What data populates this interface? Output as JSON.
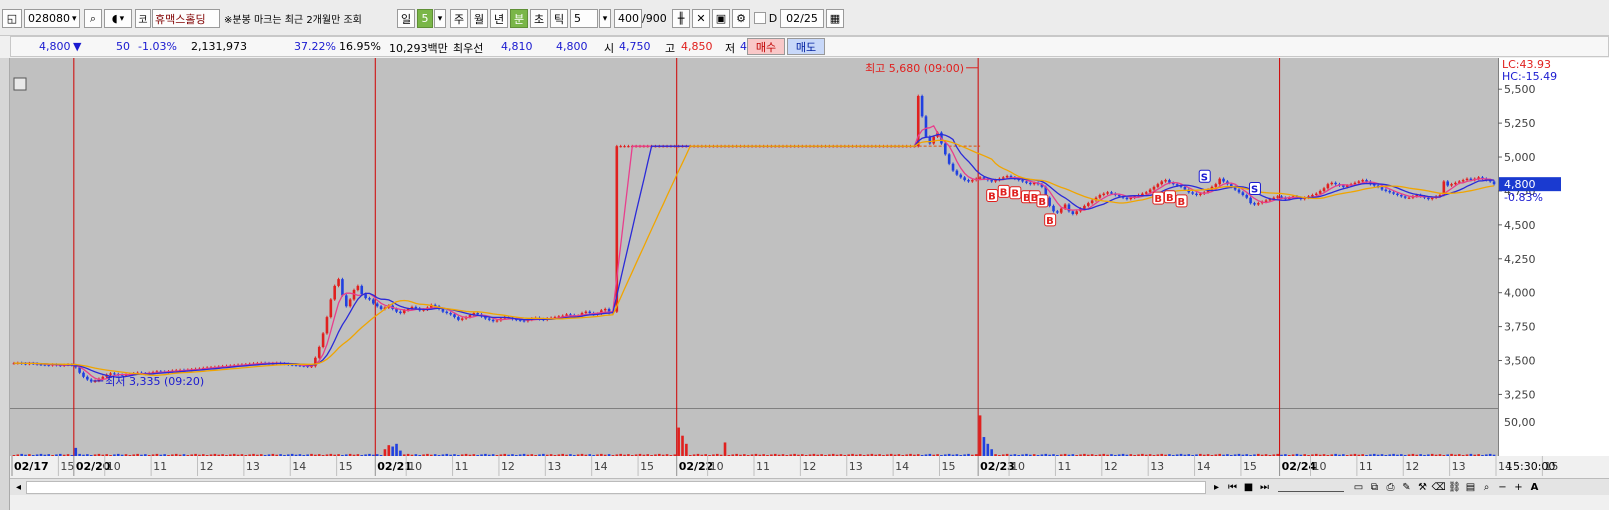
{
  "toolbar": {
    "stock_code": "028080",
    "market_badge": "코",
    "stock_name": "휴맥스홀딩",
    "notice": "※분봉 마크는 최근 2개월만 조회",
    "period_day": "일",
    "interval_value": "5",
    "period_week": "주",
    "period_month": "월",
    "period_year": "년",
    "period_minute": "분",
    "period_second": "초",
    "period_tick": "틱",
    "period_count": "5",
    "bar_count": "400",
    "bar_max": "/900",
    "check_label": "D",
    "date": "02/25"
  },
  "quote": {
    "price": "4,800",
    "change_arrow": "▼",
    "change": "50",
    "change_rate": "-1.03%",
    "volume": "2,131,973",
    "ratio1": "37.22%",
    "ratio2": "16.95%",
    "amount": "10,293백만",
    "best_label": "최우선",
    "best_ask": "4,810",
    "best_bid": "4,800",
    "open_label": "시",
    "open": "4,750",
    "high_label": "고",
    "high": "4,850",
    "low_label": "저",
    "low": "4,600",
    "buy_label": "매수",
    "sell_label": "매도"
  },
  "colors": {
    "up": "#e0201e",
    "down": "#2040e0",
    "ma5": "#e83e8c",
    "ma10": "#2a2ad8",
    "ma20": "#f0a500",
    "plot_bg": "#c0c0c0",
    "day_sep": "#d00000"
  },
  "chart_data": {
    "type": "candlestick",
    "y_ticks": [
      3250,
      3500,
      3750,
      4000,
      4250,
      4500,
      4750,
      5000,
      5250,
      5500
    ],
    "y_tick_labels": [
      "3,250",
      "3,500",
      "3,750",
      "4,000",
      "4,250",
      "4,500",
      "4,750",
      "5,000",
      "5,250",
      "5,500"
    ],
    "ylim": [
      3150,
      5730
    ],
    "vol_tick": 50,
    "vol_tick_label": "50,00",
    "lc_label": "LC:43.93",
    "hc_label": "HC:-15.49",
    "current_price": 4800,
    "current_price_label": "4,800",
    "current_change_label": "-0.83%",
    "day_length": 78,
    "days": [
      {
        "label": "02/17",
        "start": 0,
        "hours": [
          {
            "i": 12,
            "label": "15"
          }
        ]
      },
      {
        "label": "02/20",
        "start": 16,
        "hours": [
          {
            "i": 24,
            "label": "10"
          },
          {
            "i": 36,
            "label": "11"
          },
          {
            "i": 48,
            "label": "12"
          },
          {
            "i": 60,
            "label": "13"
          },
          {
            "i": 72,
            "label": "14"
          },
          {
            "i": 84,
            "label": "15"
          }
        ]
      },
      {
        "label": "02/21",
        "start": 94,
        "hours": [
          {
            "i": 102,
            "label": "10"
          },
          {
            "i": 114,
            "label": "11"
          },
          {
            "i": 126,
            "label": "12"
          },
          {
            "i": 138,
            "label": "13"
          },
          {
            "i": 150,
            "label": "14"
          },
          {
            "i": 162,
            "label": "15"
          }
        ]
      },
      {
        "label": "02/22",
        "start": 172,
        "hours": [
          {
            "i": 180,
            "label": "10"
          },
          {
            "i": 192,
            "label": "11"
          },
          {
            "i": 204,
            "label": "12"
          },
          {
            "i": 216,
            "label": "13"
          },
          {
            "i": 228,
            "label": "14"
          },
          {
            "i": 240,
            "label": "15"
          }
        ]
      },
      {
        "label": "02/23",
        "start": 250,
        "hours": [
          {
            "i": 258,
            "label": "10"
          },
          {
            "i": 270,
            "label": "11"
          },
          {
            "i": 282,
            "label": "12"
          },
          {
            "i": 294,
            "label": "13"
          },
          {
            "i": 306,
            "label": "14"
          },
          {
            "i": 318,
            "label": "15"
          }
        ]
      },
      {
        "label": "02/24",
        "start": 328,
        "hours": [
          {
            "i": 336,
            "label": "10"
          },
          {
            "i": 348,
            "label": "11"
          },
          {
            "i": 360,
            "label": "12"
          },
          {
            "i": 372,
            "label": "13"
          },
          {
            "i": 384,
            "label": "14"
          },
          {
            "i": 396,
            "label": "15"
          }
        ]
      }
    ],
    "end_time_label": "15:30:00",
    "closes": [
      3480,
      3482,
      3478,
      3475,
      3480,
      3477,
      3472,
      3470,
      3468,
      3465,
      3470,
      3466,
      3462,
      3468,
      3470,
      3466,
      3450,
      3410,
      3380,
      3360,
      3345,
      3350,
      3365,
      3380,
      3395,
      3405,
      3400,
      3395,
      3390,
      3395,
      3400,
      3405,
      3410,
      3405,
      3400,
      3408,
      3415,
      3420,
      3418,
      3415,
      3420,
      3425,
      3428,
      3430,
      3428,
      3432,
      3435,
      3438,
      3440,
      3445,
      3448,
      3450,
      3452,
      3455,
      3458,
      3460,
      3462,
      3465,
      3468,
      3470,
      3472,
      3475,
      3478,
      3480,
      3482,
      3480,
      3478,
      3480,
      3482,
      3478,
      3475,
      3470,
      3468,
      3465,
      3462,
      3460,
      3455,
      3458,
      3520,
      3600,
      3700,
      3820,
      3950,
      4050,
      4100,
      3980,
      3900,
      3950,
      4020,
      4050,
      3990,
      3960,
      3950,
      3920,
      3900,
      3880,
      3890,
      3905,
      3880,
      3860,
      3850,
      3870,
      3880,
      3895,
      3885,
      3870,
      3875,
      3890,
      3910,
      3900,
      3880,
      3860,
      3850,
      3840,
      3820,
      3800,
      3810,
      3820,
      3835,
      3850,
      3840,
      3825,
      3810,
      3800,
      3790,
      3795,
      3810,
      3820,
      3815,
      3805,
      3800,
      3795,
      3790,
      3800,
      3810,
      3815,
      3805,
      3800,
      3810,
      3815,
      3820,
      3825,
      3830,
      3840,
      3835,
      3820,
      3830,
      3850,
      3860,
      3850,
      3840,
      3845,
      3870,
      3880,
      3850,
      3860,
      5080,
      5080,
      5080,
      5080,
      5080,
      5080,
      5080,
      5080,
      5080,
      5080,
      5080,
      5080,
      5080,
      5080,
      5080,
      5080,
      5080,
      5080,
      5080,
      5080,
      5080,
      5080,
      5080,
      5080,
      5080,
      5080,
      5080,
      5080,
      5080,
      5080,
      5080,
      5080,
      5080,
      5080,
      5080,
      5080,
      5080,
      5080,
      5080,
      5080,
      5080,
      5080,
      5080,
      5080,
      5080,
      5080,
      5080,
      5080,
      5080,
      5080,
      5080,
      5080,
      5080,
      5080,
      5080,
      5080,
      5080,
      5080,
      5080,
      5080,
      5080,
      5080,
      5080,
      5080,
      5080,
      5080,
      5080,
      5080,
      5080,
      5080,
      5080,
      5080,
      5080,
      5080,
      5080,
      5080,
      5080,
      5080,
      5450,
      5300,
      5150,
      5100,
      5150,
      5180,
      5100,
      5020,
      4950,
      4900,
      4870,
      4850,
      4830,
      4820,
      4830,
      4840,
      4850,
      4840,
      4830,
      4820,
      4830,
      4840,
      4850,
      4860,
      4850,
      4840,
      4830,
      4820,
      4810,
      4800,
      4810,
      4800,
      4780,
      4700,
      4640,
      4600,
      4590,
      4620,
      4650,
      4600,
      4580,
      4600,
      4620,
      4640,
      4660,
      4680,
      4700,
      4720,
      4730,
      4740,
      4730,
      4720,
      4710,
      4700,
      4690,
      4700,
      4710,
      4720,
      4730,
      4740,
      4760,
      4780,
      4800,
      4820,
      4830,
      4810,
      4800,
      4790,
      4780,
      4760,
      4740,
      4730,
      4720,
      4730,
      4740,
      4760,
      4780,
      4800,
      4840,
      4820,
      4800,
      4780,
      4760,
      4740,
      4720,
      4700,
      4660,
      4650,
      4660,
      4670,
      4680,
      4690,
      4700,
      4710,
      4700,
      4690,
      4700,
      4710,
      4700,
      4690,
      4700,
      4710,
      4720,
      4730,
      4750,
      4770,
      4800,
      4810,
      4800,
      4790,
      4780,
      4790,
      4800,
      4810,
      4820,
      4830,
      4820,
      4800,
      4790,
      4780,
      4760,
      4750,
      4740,
      4730,
      4720,
      4710,
      4700,
      4700,
      4710,
      4720,
      4710,
      4700,
      4690,
      4700,
      4710,
      4720,
      4820,
      4790,
      4800,
      4810,
      4820,
      4830,
      4840,
      4830,
      4840,
      4850,
      4840,
      4830,
      4820,
      4800
    ],
    "ma_lines": [
      {
        "name": "ma5",
        "period": 5,
        "color": "#e83e8c"
      },
      {
        "name": "ma10",
        "period": 10,
        "color": "#2a2ad8"
      },
      {
        "name": "ma20",
        "period": 20,
        "color": "#f0a500"
      }
    ],
    "annotations": [
      {
        "text": "최고 5,680 (09:00)",
        "i": 250,
        "price": 5680,
        "side": "left",
        "color": "#e0201e"
      },
      {
        "text": "최저 3,335 (09:20)",
        "i": 20,
        "price": 3335,
        "side": "right",
        "color": "#1a1ad0"
      }
    ],
    "ref_line": {
      "price": 5080,
      "from": 172,
      "to": 250,
      "color": "#e05000"
    },
    "buy_marks": [
      253,
      256,
      259,
      262,
      264,
      266,
      268,
      296,
      299,
      302
    ],
    "buy_label": "B",
    "sell_marks": [
      308,
      321
    ],
    "sell_label": "S",
    "vol_spikes": [
      {
        "i": 16,
        "v": 12
      },
      {
        "i": 96,
        "v": 10
      },
      {
        "i": 97,
        "v": 16
      },
      {
        "i": 98,
        "v": 14
      },
      {
        "i": 99,
        "v": 18
      },
      {
        "i": 100,
        "v": 8
      },
      {
        "i": 172,
        "v": 42
      },
      {
        "i": 173,
        "v": 30
      },
      {
        "i": 174,
        "v": 18
      },
      {
        "i": 184,
        "v": 20
      },
      {
        "i": 250,
        "v": 60
      },
      {
        "i": 251,
        "v": 28
      },
      {
        "i": 252,
        "v": 18
      },
      {
        "i": 253,
        "v": 10
      }
    ],
    "vol_max": 65
  }
}
